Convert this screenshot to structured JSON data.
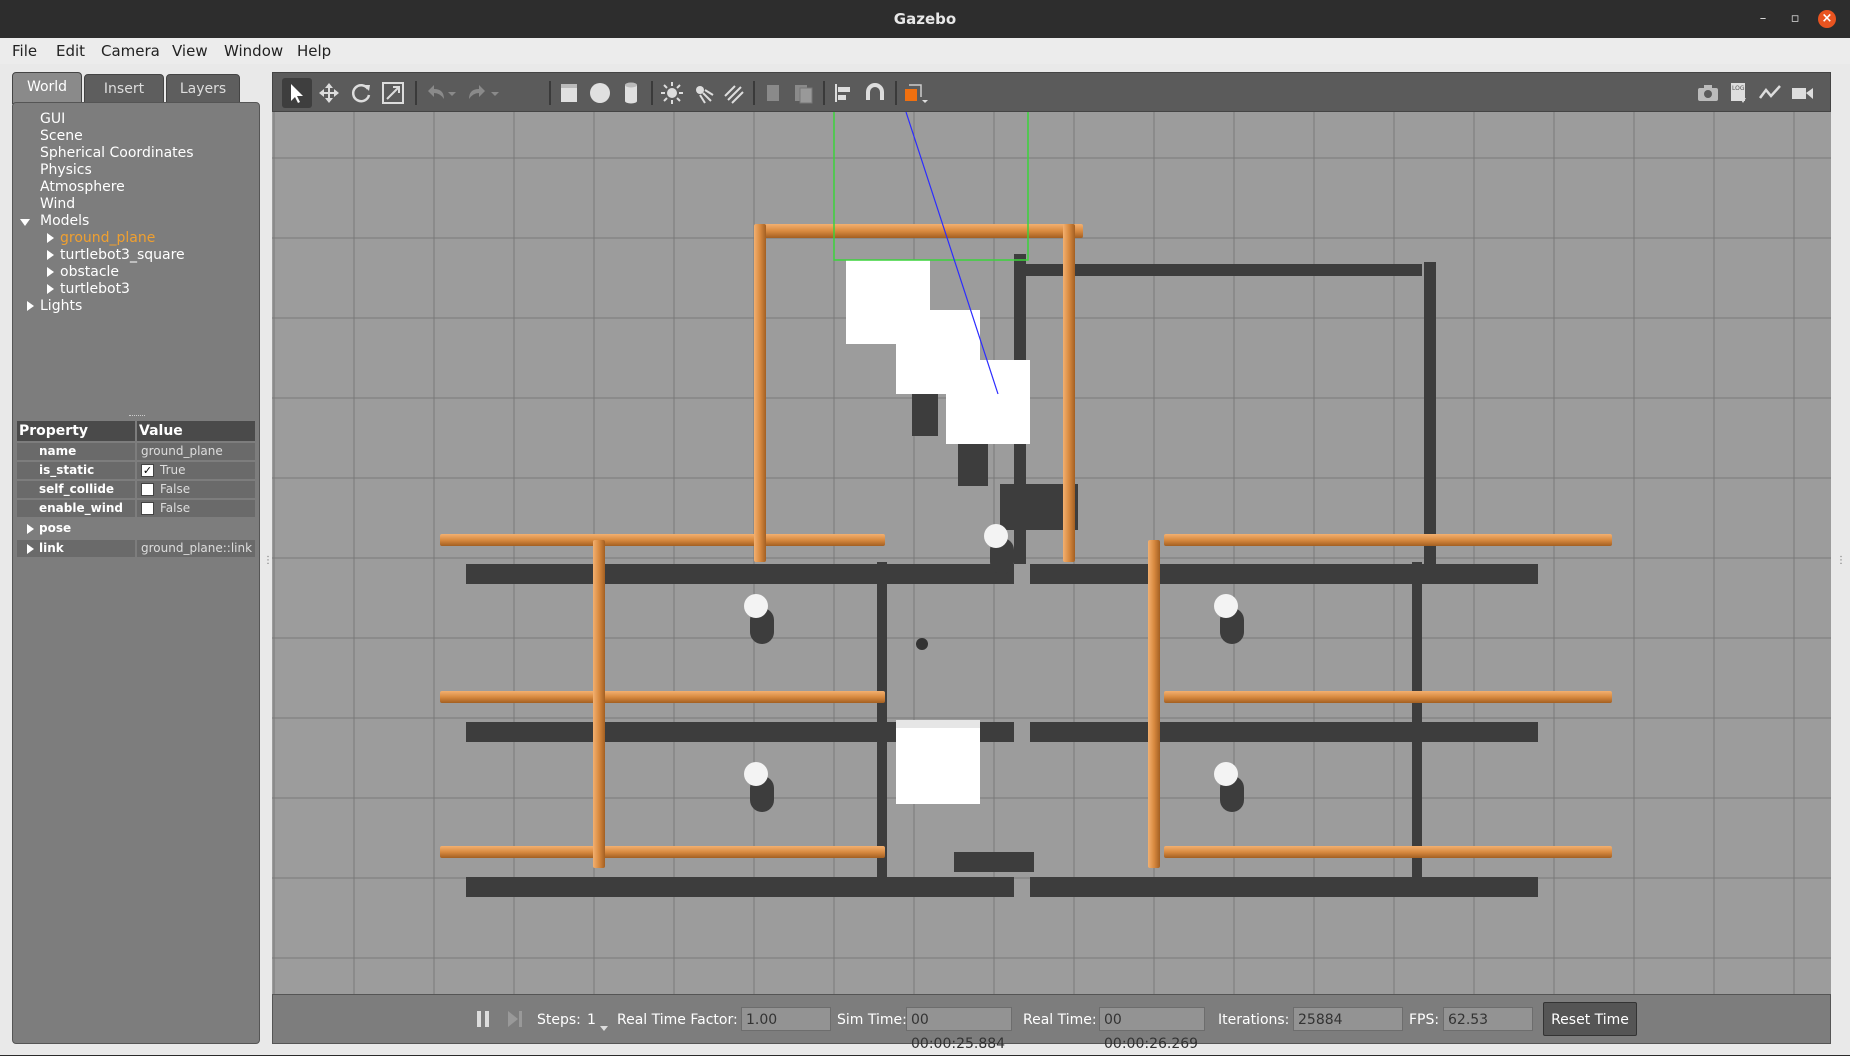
{
  "window": {
    "title": "Gazebo"
  },
  "menubar": [
    "File",
    "Edit",
    "Camera",
    "View",
    "Window",
    "Help"
  ],
  "tabs": {
    "world": "World",
    "insert": "Insert",
    "layers": "Layers"
  },
  "tree": {
    "gui": "GUI",
    "scene": "Scene",
    "spherical": "Spherical Coordinates",
    "physics": "Physics",
    "atmosphere": "Atmosphere",
    "wind": "Wind",
    "models": "Models",
    "model_items": [
      "ground_plane",
      "turtlebot3_square",
      "obstacle",
      "turtlebot3"
    ],
    "lights": "Lights",
    "selected": "ground_plane"
  },
  "properties": {
    "header_property": "Property",
    "header_value": "Value",
    "rows": [
      {
        "name": "name",
        "value": "ground_plane"
      },
      {
        "name": "is_static",
        "value": "True",
        "checked": true
      },
      {
        "name": "self_collide",
        "value": "False",
        "checked": false
      },
      {
        "name": "enable_wind",
        "value": "False",
        "checked": false
      },
      {
        "name": "pose",
        "value": ""
      },
      {
        "name": "link",
        "value": "ground_plane::link"
      }
    ]
  },
  "toolbar": {
    "icons": [
      "select-mode-icon",
      "translate-mode-icon",
      "rotate-mode-icon",
      "scale-mode-icon",
      "undo-icon",
      "redo-icon",
      "box-shape-icon",
      "sphere-shape-icon",
      "cylinder-shape-icon",
      "point-light-icon",
      "spot-light-icon",
      "directional-light-icon",
      "copy-icon",
      "paste-icon",
      "align-icon",
      "snap-icon",
      "view-angle-icon",
      "screenshot-icon",
      "log-icon",
      "plot-icon",
      "record-video-icon"
    ]
  },
  "bottombar": {
    "steps_label": "Steps:",
    "steps_value": "1",
    "rtf_label": "Real Time Factor:",
    "rtf_value": "1.00",
    "simtime_label": "Sim Time:",
    "simtime_value": "00 00:00:25.884",
    "realtime_label": "Real Time:",
    "realtime_value": "00 00:00:26.269",
    "iterations_label": "Iterations:",
    "iterations_value": "25884",
    "fps_label": "FPS:",
    "fps_value": "62.53",
    "reset_label": "Reset Time"
  },
  "colors": {
    "ground": "#9c9c9c",
    "grid": "#7a7a7a",
    "wall": "#d88a40",
    "wall_dark": "#a35f22",
    "shadow": "#3d3d3d",
    "box": "#ffffff",
    "selected_text": "#f0a030",
    "close_button": "#e95420"
  }
}
